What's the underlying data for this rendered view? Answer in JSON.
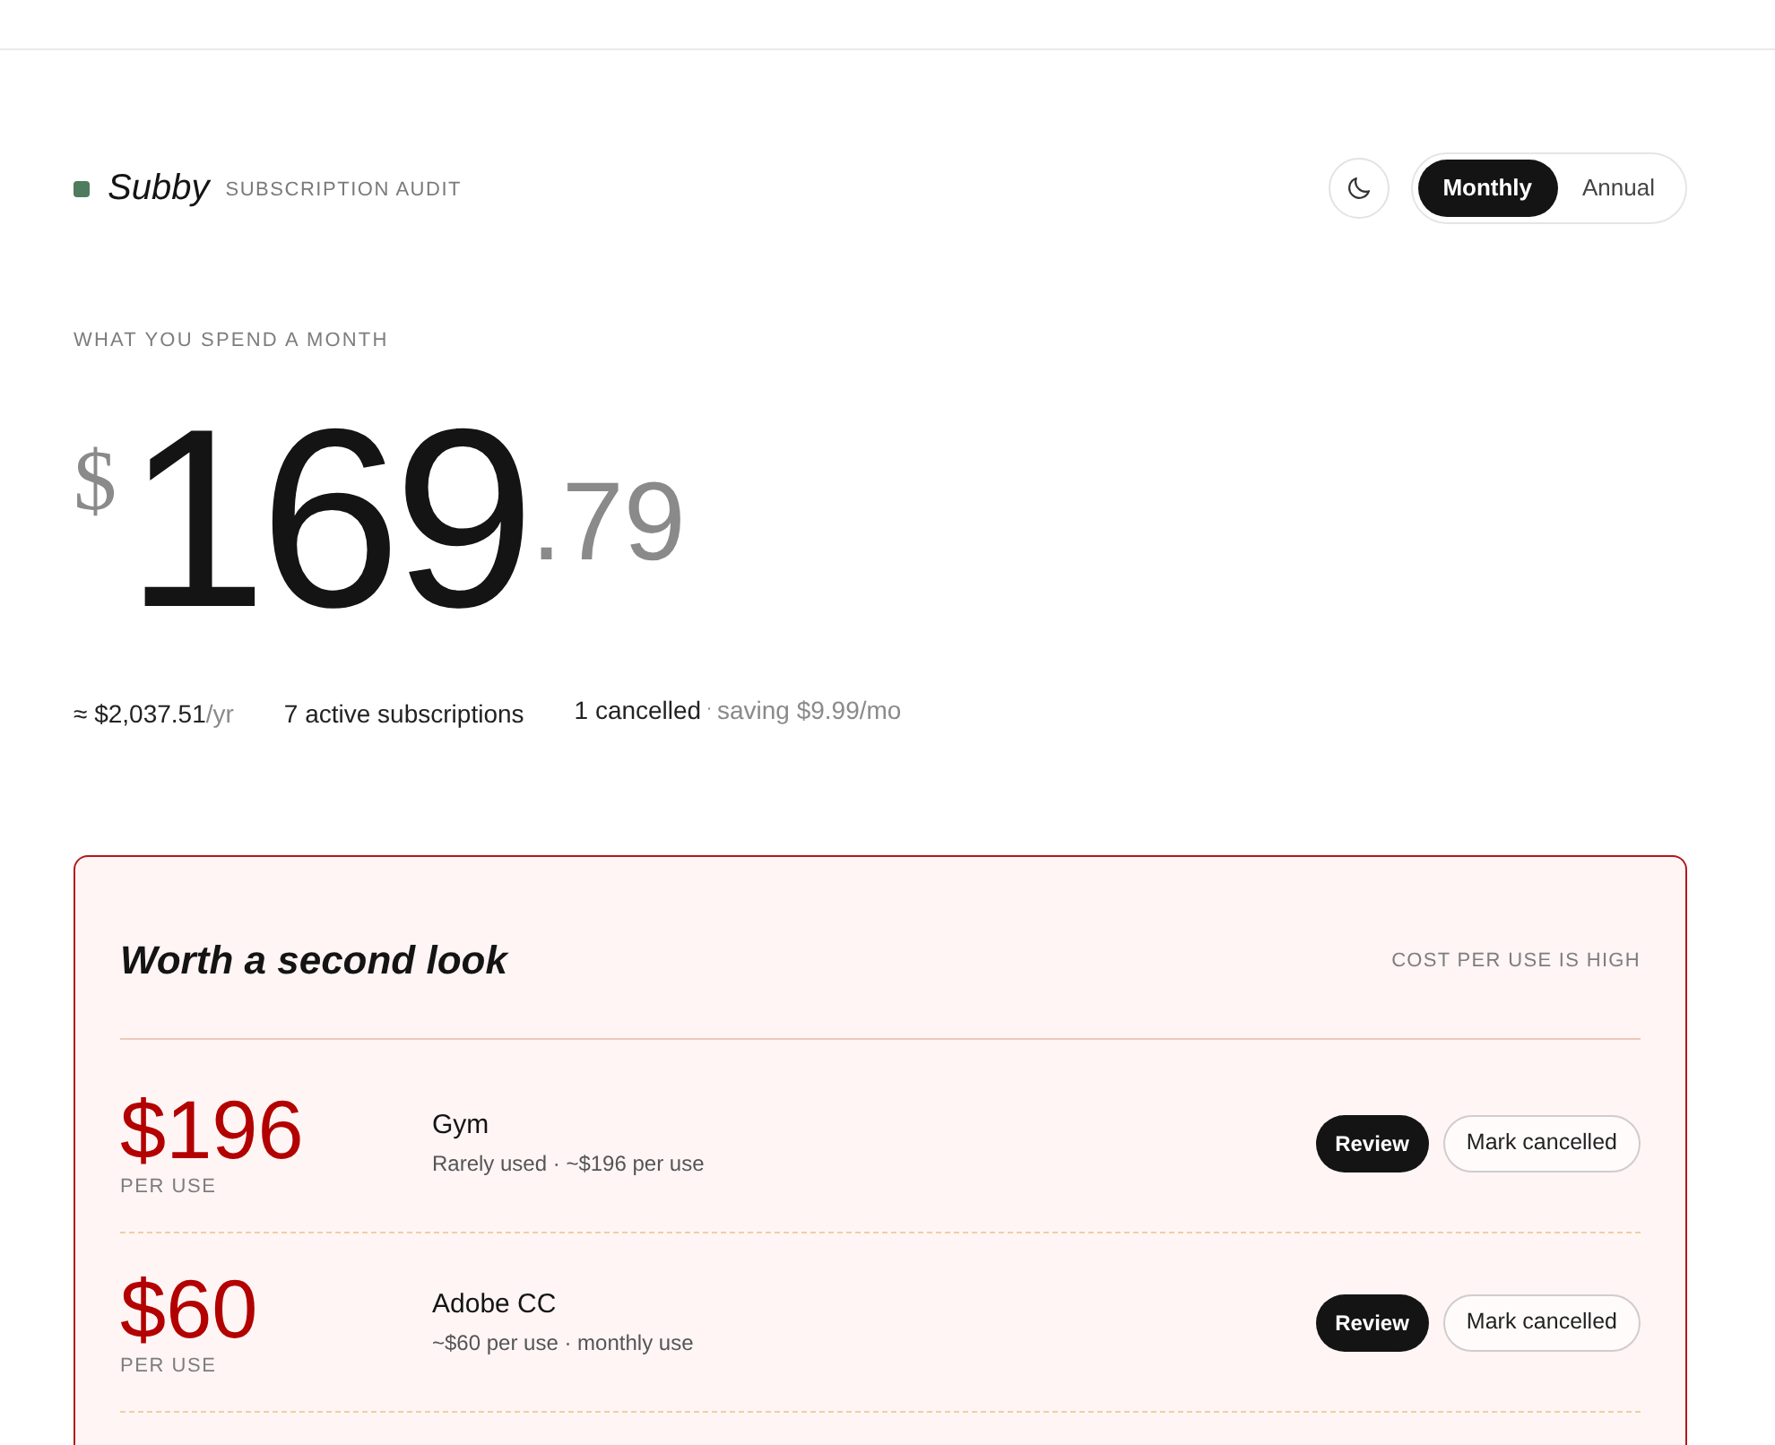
{
  "header": {
    "brand": "Subby",
    "subtitle": "SUBSCRIPTION AUDIT",
    "period_toggle": [
      {
        "label": "Monthly",
        "selected": true
      },
      {
        "label": "Annual",
        "selected": false
      }
    ]
  },
  "summary": {
    "label": "WHAT YOU SPEND A MONTH",
    "currency": "$",
    "amount_whole": "169",
    "amount_cents": ".79",
    "stats": [
      {
        "text": "≈ $2,037.51",
        "muted_text": "/yr"
      },
      {
        "text": "7 active subscriptions"
      },
      {
        "text": "1 cancelled",
        "separator": "·",
        "muted_text": "saving $9.99/mo"
      }
    ]
  },
  "review_panel": {
    "title": "Worth a second look",
    "note": "COST PER USE IS HIGH",
    "items": [
      {
        "cost": "$196",
        "cost_label": "PER USE",
        "name": "Gym",
        "detail": "Rarely used · ~$196 per use",
        "actions": [
          {
            "label": "Review",
            "kind": "primary"
          },
          {
            "label": "Mark cancelled",
            "kind": "secondary"
          }
        ]
      },
      {
        "cost": "$60",
        "cost_label": "PER USE",
        "name": "Adobe CC",
        "detail": "~$60 per use · monthly use",
        "actions": [
          {
            "label": "Review",
            "kind": "primary"
          },
          {
            "label": "Mark cancelled",
            "kind": "secondary"
          }
        ]
      }
    ]
  }
}
